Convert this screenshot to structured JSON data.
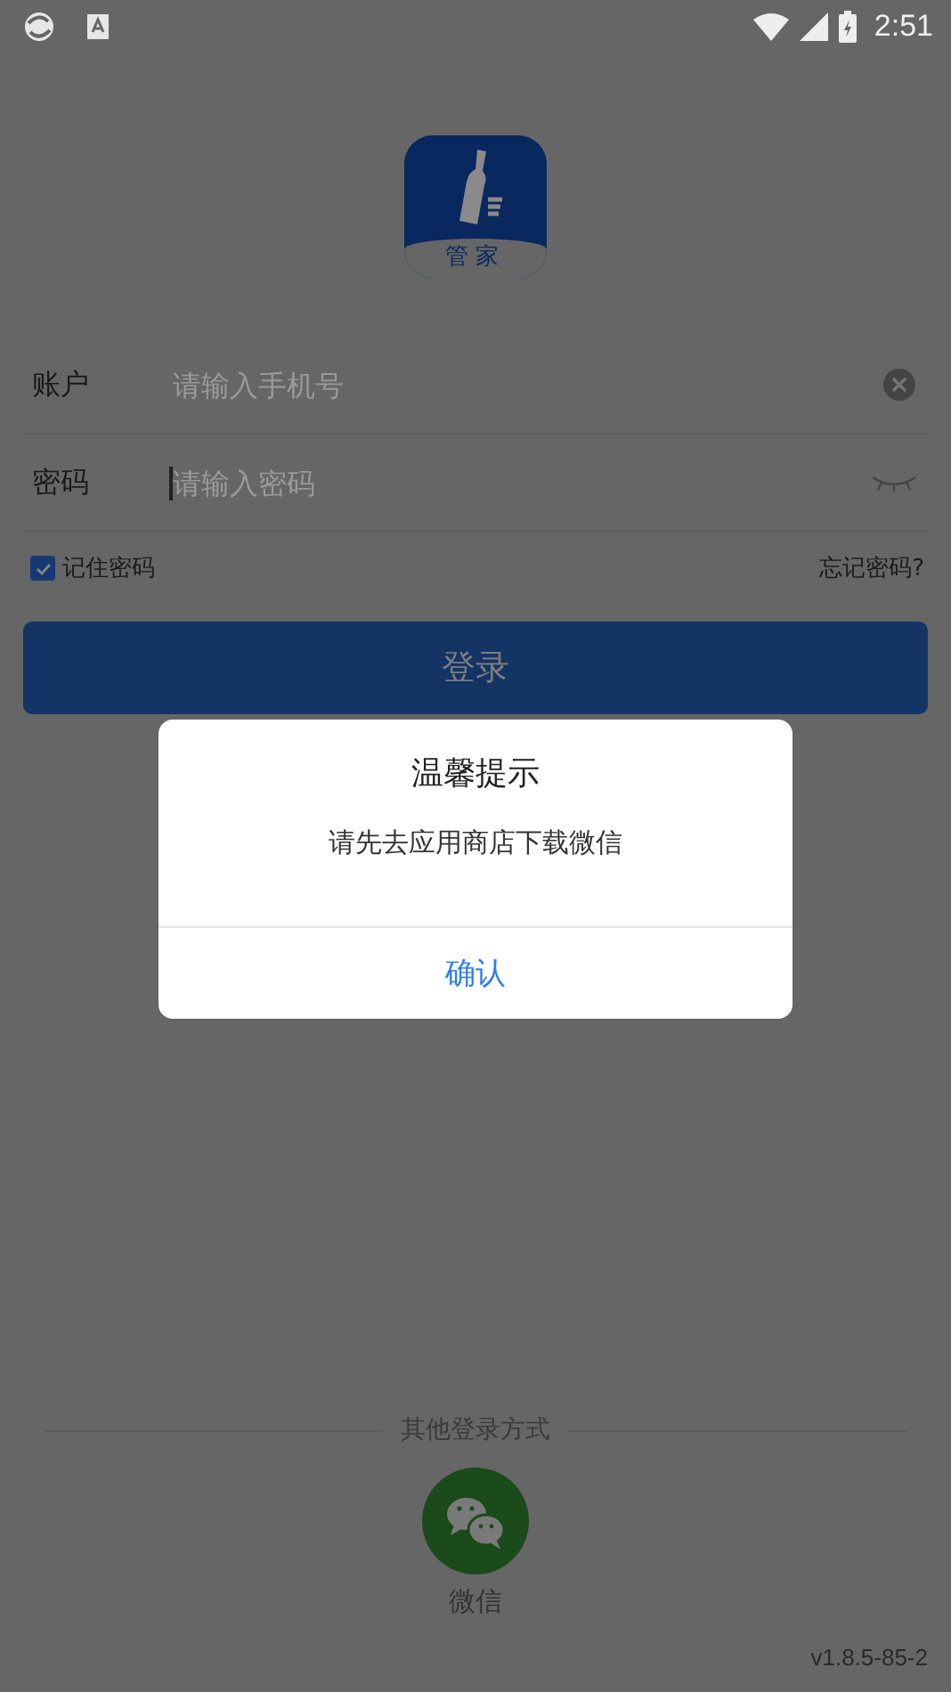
{
  "status_bar": {
    "time": "2:51"
  },
  "logo": {
    "caption": "管家"
  },
  "fields": [
    {
      "label": "账户",
      "placeholder": "请输入手机号",
      "kind": "clear"
    },
    {
      "label": "密码",
      "placeholder": "请输入密码",
      "kind": "eye"
    }
  ],
  "remember": {
    "label": "记住密码",
    "checked": true
  },
  "forgot_link": "忘记密码?",
  "login_button": "登录",
  "other_login": {
    "title": "其他登录方式",
    "options": [
      {
        "label": "微信"
      }
    ]
  },
  "version": "v1.8.5-85-2",
  "dialog": {
    "title": "温馨提示",
    "message": "请先去应用商店下载微信",
    "confirm": "确认"
  }
}
